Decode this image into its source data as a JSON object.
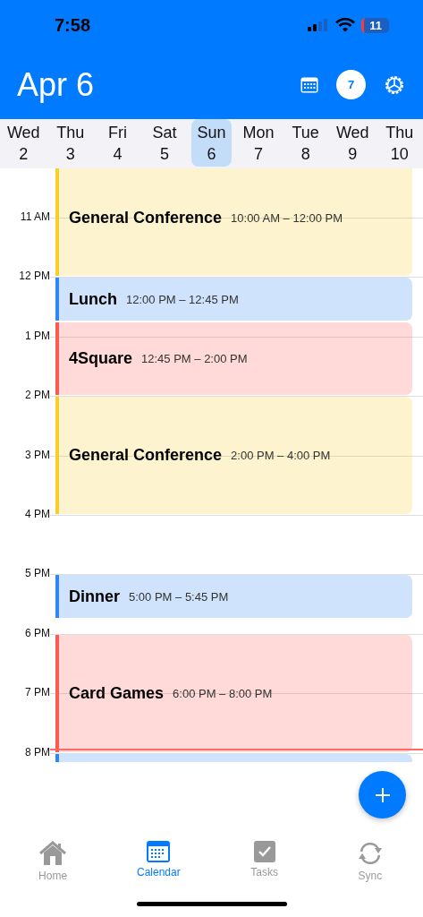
{
  "status_bar": {
    "time": "7:58",
    "battery": "11"
  },
  "header": {
    "title": "Apr 6",
    "badge": "7"
  },
  "days": [
    {
      "weekday": "Wed",
      "date": "2",
      "selected": false
    },
    {
      "weekday": "Thu",
      "date": "3",
      "selected": false
    },
    {
      "weekday": "Fri",
      "date": "4",
      "selected": false
    },
    {
      "weekday": "Sat",
      "date": "5",
      "selected": false
    },
    {
      "weekday": "Sun",
      "date": "6",
      "selected": true
    },
    {
      "weekday": "Mon",
      "date": "7",
      "selected": false
    },
    {
      "weekday": "Tue",
      "date": "8",
      "selected": false
    },
    {
      "weekday": "Wed",
      "date": "9",
      "selected": false
    },
    {
      "weekday": "Thu",
      "date": "10",
      "selected": false
    }
  ],
  "hours": [
    "11 AM",
    "12 PM",
    "1 PM",
    "2 PM",
    "3 PM",
    "4 PM",
    "5 PM",
    "6 PM",
    "7 PM",
    "8 PM"
  ],
  "events": [
    {
      "title": "General Conference",
      "time": "10:00 AM – 12:00 PM",
      "color": "#f8cf2a"
    },
    {
      "title": "Lunch",
      "time": "12:00 PM – 12:45 PM",
      "color": "#2f86f6"
    },
    {
      "title": "4Square",
      "time": "12:45 PM – 2:00 PM",
      "color": "#fd5b52"
    },
    {
      "title": "General Conference",
      "time": "2:00 PM – 4:00 PM",
      "color": "#f8cf2a"
    },
    {
      "title": "Dinner",
      "time": "5:00 PM – 5:45 PM",
      "color": "#2f86f6"
    },
    {
      "title": "Card Games",
      "time": "6:00 PM – 8:00 PM",
      "color": "#fd5b52"
    },
    {
      "color": "#2f86f6"
    }
  ],
  "tabs": [
    {
      "label": "Home",
      "kind": "home",
      "selected": false
    },
    {
      "label": "Calendar",
      "kind": "calendar",
      "selected": true
    },
    {
      "label": "Tasks",
      "kind": "tasks",
      "selected": false
    },
    {
      "label": "Sync",
      "kind": "sync",
      "selected": false
    }
  ]
}
